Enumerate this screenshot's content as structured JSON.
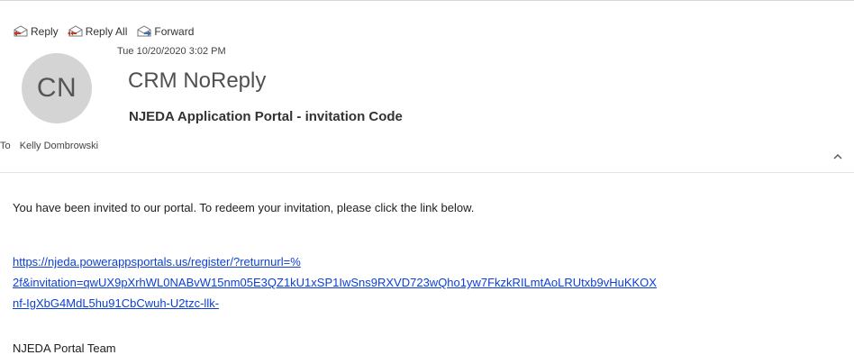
{
  "toolbar": {
    "reply_label": "Reply",
    "reply_all_label": "Reply All",
    "forward_label": "Forward"
  },
  "message": {
    "avatar_initials": "CN",
    "date": "Tue 10/20/2020 3:02 PM",
    "sender": "CRM NoReply",
    "subject": "NJEDA Application Portal - invitation Code",
    "to_label": "To",
    "recipient": "Kelly Dombrowski"
  },
  "content": {
    "intro": "You have been invited to our portal. To redeem your invitation, please click the link below.",
    "link_lines": [
      "https://njeda.powerappsportals.us/register/?returnurl=%",
      "2f&invitation=qwUX9pXrhWL0NABvW15nm05E3QZ1kU1xSP1IwSns9RXVD723wQho1yw7FkzkRILmtAoLRUtxb9vHuKKOX",
      "nf-IgXbG4MdL5hu91CbCwuh-U2tzc-llk-"
    ],
    "signature": "NJEDA Portal Team"
  },
  "colors": {
    "link": "#0b3fd6",
    "avatar_bg": "#d4d4d4",
    "icon_accent": "#c0392b",
    "icon_blue": "#3a6ea5"
  },
  "icons": [
    "reply-icon",
    "reply-all-icon",
    "forward-icon",
    "chevron-up-icon"
  ]
}
